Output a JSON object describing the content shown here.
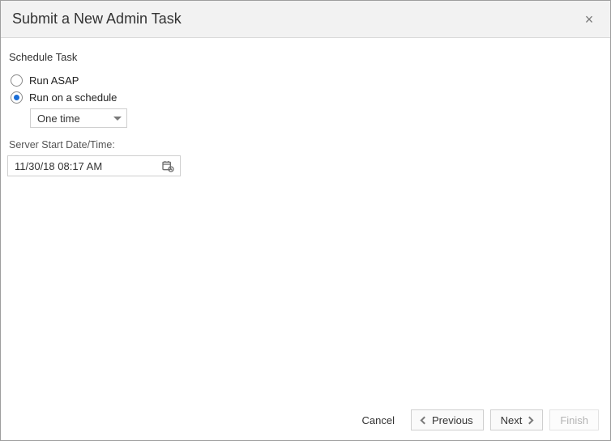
{
  "dialog": {
    "title": "Submit a New Admin Task",
    "close_tooltip": "Close"
  },
  "section": {
    "schedule_heading": "Schedule Task"
  },
  "radios": {
    "run_asap": {
      "label": "Run ASAP",
      "checked": false
    },
    "run_schedule": {
      "label": "Run on a schedule",
      "checked": true
    }
  },
  "frequency": {
    "selected": "One time"
  },
  "start_datetime": {
    "label": "Server Start Date/Time:",
    "value": "11/30/18 08:17 AM"
  },
  "footer": {
    "cancel": "Cancel",
    "previous": "Previous",
    "next": "Next",
    "finish": "Finish"
  }
}
